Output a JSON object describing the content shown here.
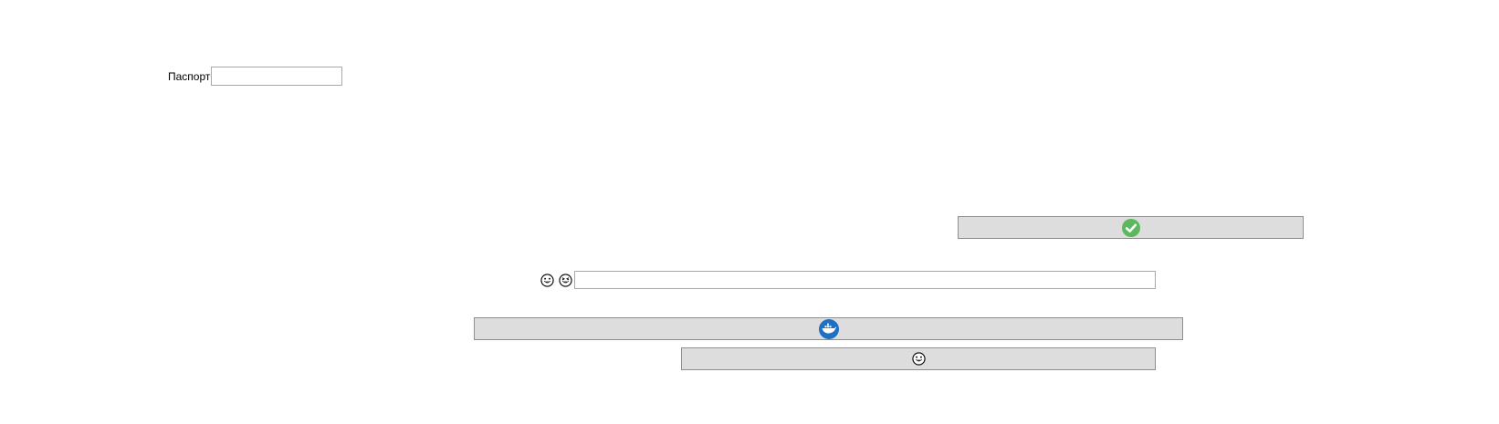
{
  "form": {
    "passport_label": "Паспорт",
    "passport_value": "",
    "emoji_field_value": ""
  },
  "buttons": {
    "confirm": {
      "icon": "green-checkmark-circle-icon",
      "color": "#5cb85c"
    },
    "docker": {
      "icon": "docker-whale-icon",
      "color": "#1f6fc5"
    },
    "emoji": {
      "icon": "grinning-face-icon"
    }
  },
  "emoji_field": {
    "icons": [
      "grinning-face-icon",
      "grinning-squinting-face-icon"
    ]
  }
}
